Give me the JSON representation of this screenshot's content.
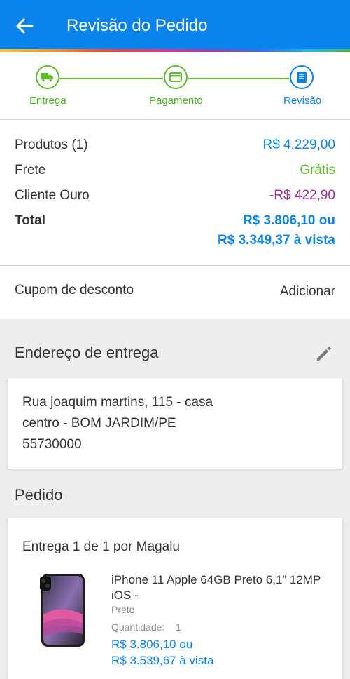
{
  "header": {
    "title": "Revisão do Pedido",
    "back_icon": "arrow-back-icon",
    "bar_color": "#0a84ea"
  },
  "stepper": {
    "steps": [
      {
        "label": "Entrega",
        "icon": "truck-icon",
        "status": "done"
      },
      {
        "label": "Pagamento",
        "icon": "credit-card-icon",
        "status": "done"
      },
      {
        "label": "Revisão",
        "icon": "receipt-icon",
        "status": "current"
      }
    ],
    "done_color": "#5fbf2a",
    "current_color": "#0a84ea"
  },
  "summary": {
    "products_label": "Produtos (1)",
    "products_value": "R$ 4.229,00",
    "shipping_label": "Frete",
    "shipping_value": "Grátis",
    "gold_label": "Cliente Ouro",
    "gold_value": "-R$ 422,90",
    "total_label": "Total",
    "total_value": "R$ 3.806,10 ou",
    "total_cash_value": "R$ 3.349,37 à vista"
  },
  "coupon": {
    "label": "Cupom de desconto",
    "action": "Adicionar"
  },
  "address": {
    "title": "Endereço de entrega",
    "edit_icon": "pencil-icon",
    "line1": "Rua joaquim martins, 115 - casa",
    "line2": "centro - BOM JARDIM/PE",
    "line3": "55730000"
  },
  "order": {
    "title": "Pedido",
    "delivery_label": "Entrega 1 de 1 por Magalu",
    "product": {
      "name": "iPhone 11 Apple 64GB Preto 6,1” 12MP iOS -",
      "color": "Preto",
      "quantity_label": "Quantidade:",
      "quantity": "1",
      "price": "R$ 3.806,10 ou",
      "price_cash": "R$ 3.539,67 à vista",
      "image_icon": "smartphone-icon"
    }
  }
}
